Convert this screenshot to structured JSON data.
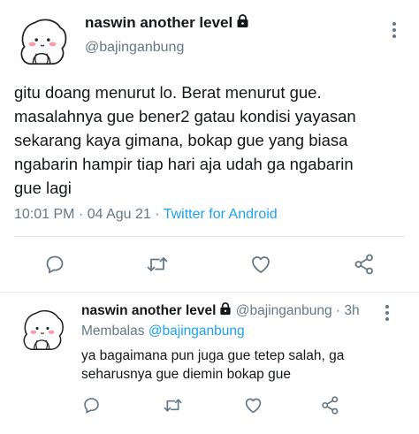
{
  "main_tweet": {
    "author_name": "naswin another level",
    "author_handle": "@bajinganbung",
    "text_lines": [
      "gitu doang menurut lo. Berat menurut gue.",
      "masalahnya gue bener2 gatau kondisi yayasan",
      "sekarang kaya gimana, bokap gue yang biasa",
      "ngabarin hampir tiap hari aja udah ga ngabarin",
      "gue lagi"
    ],
    "time": "10:01 PM",
    "separator1": " · ",
    "date": "04 Agu 21",
    "separator2": " · ",
    "source": "Twitter for Android"
  },
  "reply_tweet": {
    "author_name": "naswin another level",
    "author_handle": "@bajinganbung",
    "separator": " · ",
    "age": "3h",
    "replying_prefix": "Membalas ",
    "replying_to": "@bajinganbung",
    "text": "ya bagaimana pun juga gue tetep salah, ga seharusnya gue diemin bokap gue"
  },
  "icons": {
    "lock": "lock-icon",
    "reply": "reply-icon",
    "retweet": "retweet-icon",
    "like": "heart-icon",
    "share": "share-icon",
    "more": "more-vertical-icon"
  },
  "colors": {
    "text": "#14171a",
    "secondary": "#657786",
    "link": "#1da1f2",
    "divider": "#e1e8ed",
    "icon": "#657786"
  }
}
